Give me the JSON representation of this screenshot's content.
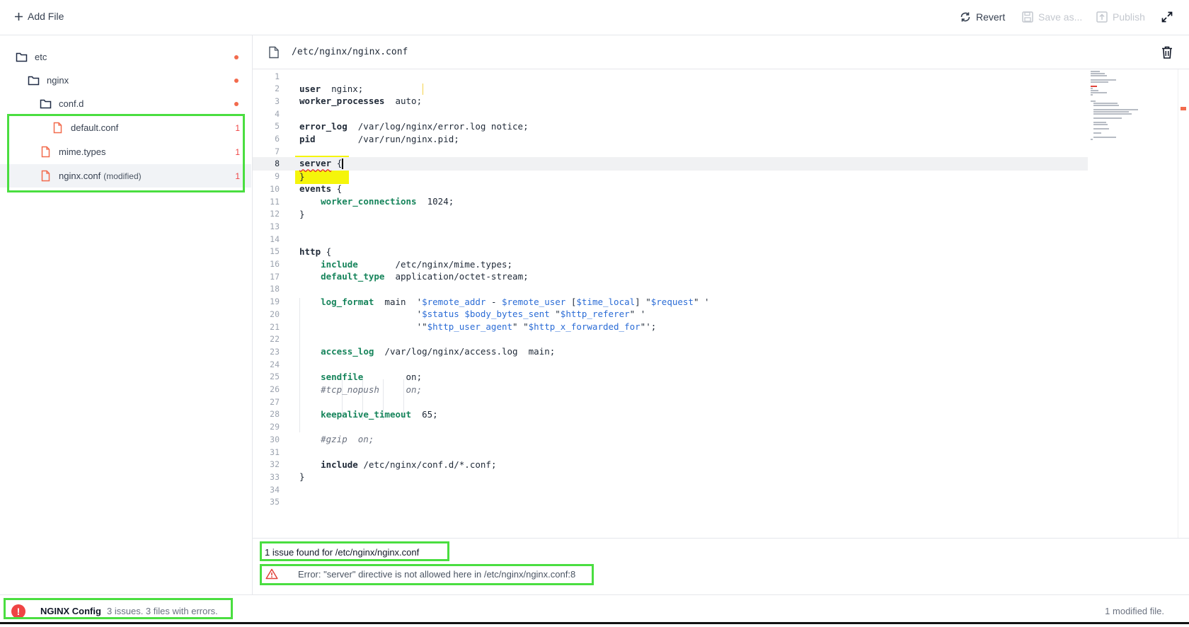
{
  "toolbar": {
    "add_file": "Add File",
    "revert": "Revert",
    "save_as": "Save as...",
    "publish": "Publish"
  },
  "sidebar": {
    "items": [
      {
        "label": "etc",
        "type": "folder",
        "has_changes": true
      },
      {
        "label": "nginx",
        "type": "folder",
        "has_changes": true
      },
      {
        "label": "conf.d",
        "type": "folder",
        "has_changes": true
      },
      {
        "label": "default.conf",
        "type": "file",
        "error_count": "1"
      },
      {
        "label": "mime.types",
        "type": "file",
        "error_count": "1"
      },
      {
        "label": "nginx.conf",
        "modified_tag": "(modified)",
        "type": "file",
        "error_count": "1",
        "selected": true
      }
    ]
  },
  "editor": {
    "path": "/etc/nginx/nginx.conf",
    "current_line": 8,
    "lines": [
      {
        "n": "1",
        "text": ""
      },
      {
        "n": "2",
        "text": "user  nginx;"
      },
      {
        "n": "3",
        "text": "worker_processes  auto;"
      },
      {
        "n": "4",
        "text": ""
      },
      {
        "n": "5",
        "text": "error_log  /var/log/nginx/error.log notice;"
      },
      {
        "n": "6",
        "text": "pid        /var/run/nginx.pid;"
      },
      {
        "n": "7",
        "text": ""
      },
      {
        "n": "8",
        "text": "server {"
      },
      {
        "n": "9",
        "text": "}"
      },
      {
        "n": "10",
        "text": "events {"
      },
      {
        "n": "11",
        "text": "    worker_connections  1024;"
      },
      {
        "n": "12",
        "text": "}"
      },
      {
        "n": "13",
        "text": ""
      },
      {
        "n": "14",
        "text": ""
      },
      {
        "n": "15",
        "text": "http {"
      },
      {
        "n": "16",
        "text": "    include       /etc/nginx/mime.types;"
      },
      {
        "n": "17",
        "text": "    default_type  application/octet-stream;"
      },
      {
        "n": "18",
        "text": ""
      },
      {
        "n": "19",
        "text": "    log_format  main  '$remote_addr - $remote_user [$time_local] \"$request\" '"
      },
      {
        "n": "20",
        "text": "                      '$status $body_bytes_sent \"$http_referer\" '"
      },
      {
        "n": "21",
        "text": "                      '\"$http_user_agent\" \"$http_x_forwarded_for\"';"
      },
      {
        "n": "22",
        "text": ""
      },
      {
        "n": "23",
        "text": "    access_log  /var/log/nginx/access.log  main;"
      },
      {
        "n": "24",
        "text": ""
      },
      {
        "n": "25",
        "text": "    sendfile        on;"
      },
      {
        "n": "26",
        "text": "    #tcp_nopush     on;"
      },
      {
        "n": "27",
        "text": ""
      },
      {
        "n": "28",
        "text": "    keepalive_timeout  65;"
      },
      {
        "n": "29",
        "text": ""
      },
      {
        "n": "30",
        "text": "    #gzip  on;"
      },
      {
        "n": "31",
        "text": ""
      },
      {
        "n": "32",
        "text": "    include /etc/nginx/conf.d/*.conf;"
      },
      {
        "n": "33",
        "text": "}"
      },
      {
        "n": "34",
        "text": ""
      },
      {
        "n": "35",
        "text": ""
      }
    ]
  },
  "problems": {
    "title": "1 issue found for /etc/nginx/nginx.conf",
    "message": "Error: \"server\" directive is not allowed here in /etc/nginx/nginx.conf:8"
  },
  "status": {
    "app_name": "NGINX Config",
    "summary": "3 issues.  3 files with errors.",
    "modified": "1 modified file."
  },
  "colors": {
    "error": "#ef4444",
    "accent_green": "#16845b",
    "highlight_yellow": "#f5f50a",
    "annotation_box": "#4ade40"
  }
}
